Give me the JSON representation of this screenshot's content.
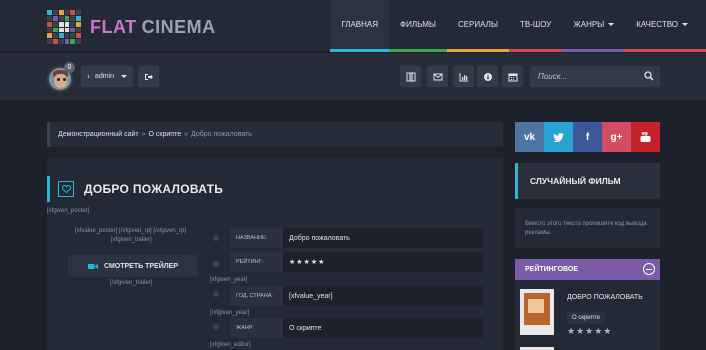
{
  "header": {
    "logo_part1": "FLAT",
    "logo_part2": "CINEMA",
    "nav": [
      {
        "label": "Главная",
        "active": true,
        "underline": "#2bb6d6"
      },
      {
        "label": "Фильмы",
        "underline": "#3fa64f"
      },
      {
        "label": "Сериалы",
        "underline": "#e8a33a"
      },
      {
        "label": "ТВ-шоу",
        "underline": "#d34b4b"
      },
      {
        "label": "Жанры",
        "dropdown": true,
        "underline": "#7b5ba7"
      },
      {
        "label": "Качество",
        "dropdown": true,
        "underline": "#d34b4b"
      }
    ]
  },
  "user": {
    "badge": "0",
    "name": "admin"
  },
  "toolbar_icons": [
    "film-icon",
    "envelope-icon",
    "chart-icon",
    "info-icon",
    "calendar-icon"
  ],
  "search": {
    "placeholder": "Поиск..."
  },
  "breadcrumb": {
    "home": "Демонстрационный сайт",
    "sep": "»",
    "page": "О скрипте",
    "current": "Добро пожаловать"
  },
  "article": {
    "title": "ДОБРО ПОЖАЛОВАТЬ",
    "tag_poster": "[xfgiven_poster]",
    "tag_values_1": "[xfvalue_poster] [/xfgiven_rp] [/xfgiven_rp]",
    "tag_values_2": "[xfgiven_trailer]",
    "trailer_button": "СМОТРЕТЬ ТРЕЙЛЕР",
    "tag_trailer_end": "[/xfgiven_trailer]",
    "tag_year": "[xfgiven_year]",
    "tag_year_end": "[/xfgiven_year]",
    "tag_editor": "[xfgiven_editor]",
    "fields": [
      {
        "label": "Название:",
        "value": "Добро пожаловать"
      },
      {
        "label": "Рейтинг:",
        "value": "★★★★★"
      },
      {
        "label": "Год, страна:",
        "value": "[xfvalue_year]"
      },
      {
        "label": "Жанр:",
        "value": "О скрипте"
      }
    ]
  },
  "sidebar": {
    "social": [
      {
        "icon": "vk-icon",
        "glyph": "vk",
        "color": "#4c75a3"
      },
      {
        "icon": "twitter-icon",
        "glyph": "🐦",
        "color": "#2aa3d3"
      },
      {
        "icon": "facebook-icon",
        "glyph": "f",
        "color": "#3b5998"
      },
      {
        "icon": "google-plus-icon",
        "glyph": "g+",
        "color": "#d24c63"
      },
      {
        "icon": "youtube-icon",
        "glyph": "▶",
        "color": "#c4232b"
      }
    ],
    "random_title": "СЛУЧАЙНЫЙ ФИЛЬМ",
    "random_text": "Вместо этого текста пропишите код вывода рекламы.",
    "rating_title": "РЕЙТИНГОВОЕ",
    "top_film": {
      "title": "ДОБРО ПОЖАЛОВАТЬ",
      "genre": "О скрипте",
      "stars": "★★★★★"
    }
  }
}
